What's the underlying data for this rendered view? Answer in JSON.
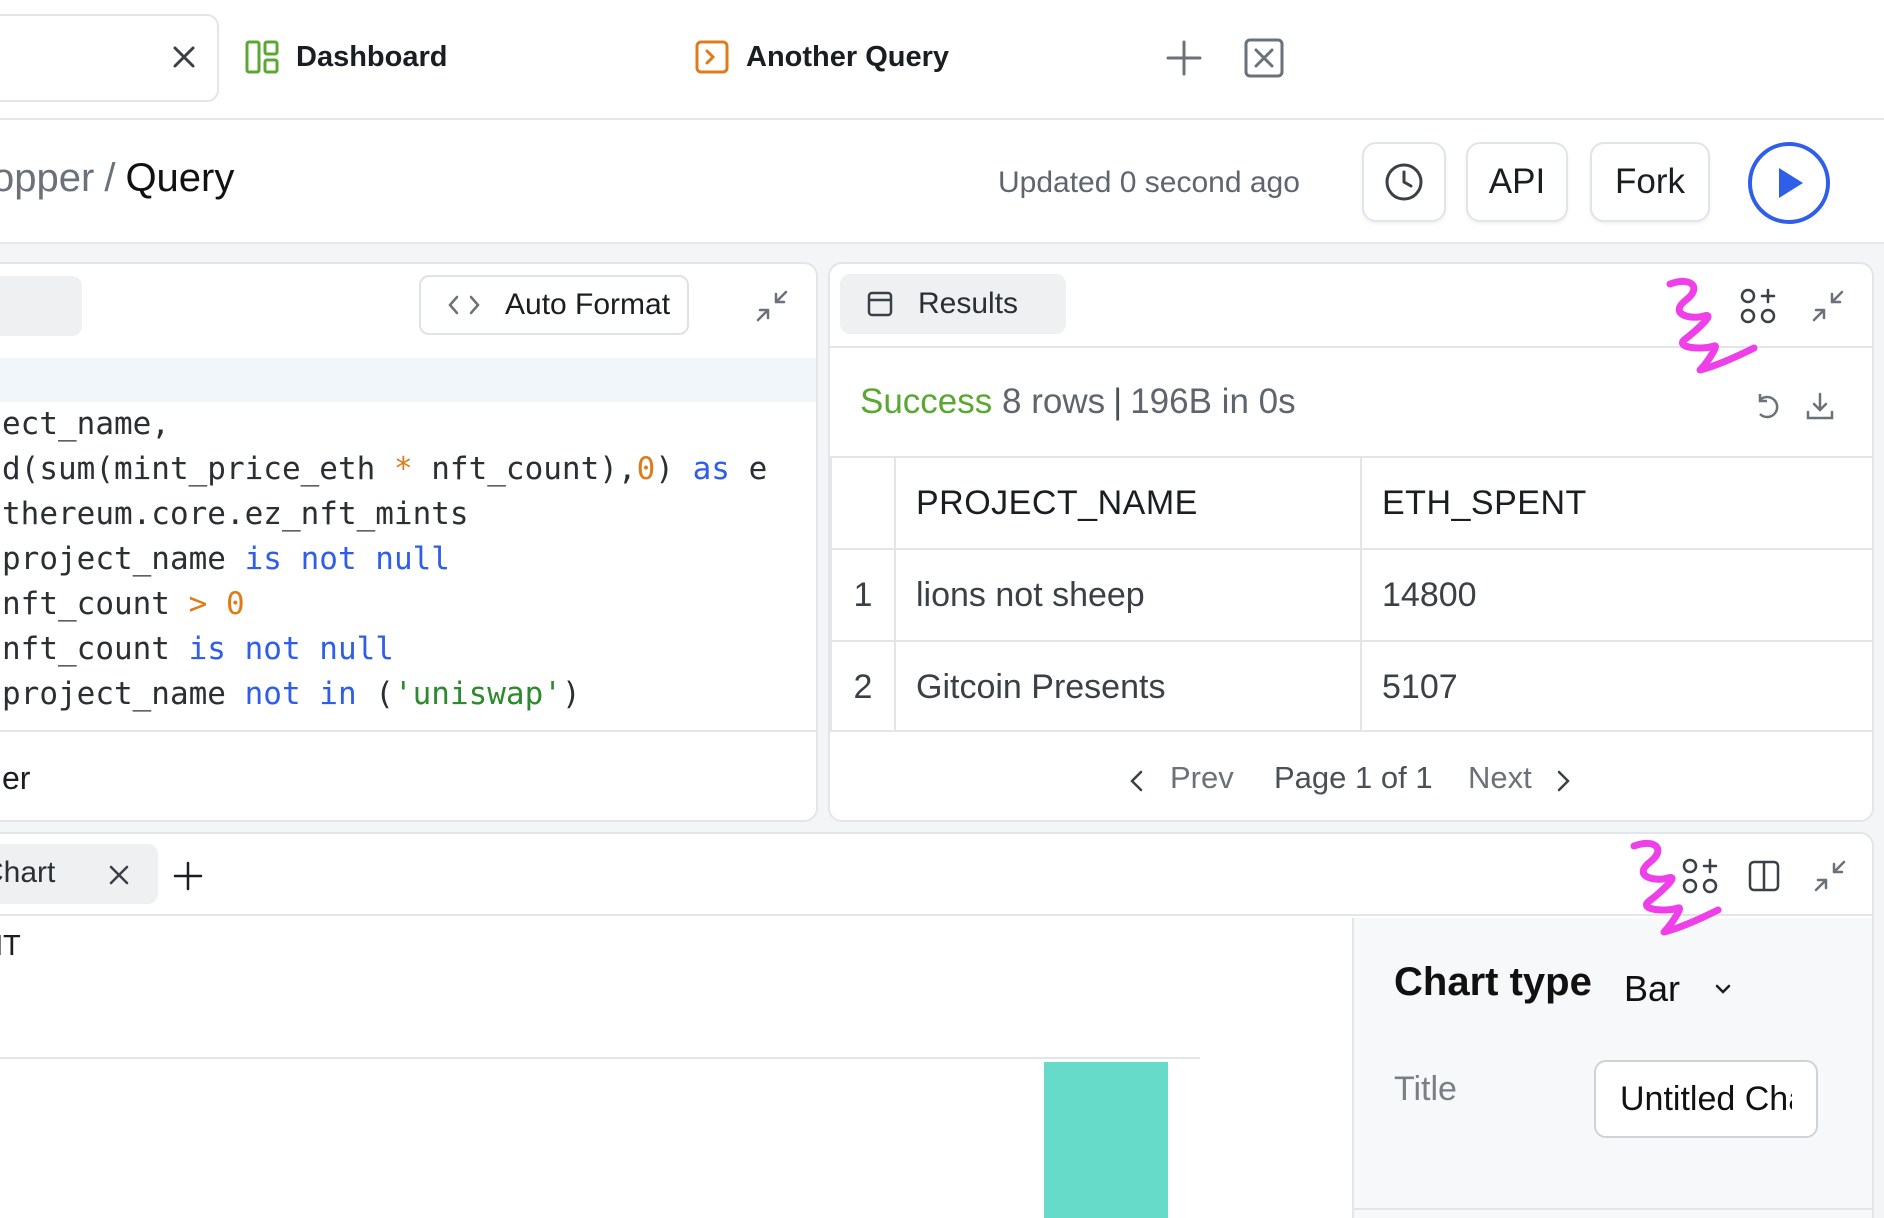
{
  "tabs": {
    "items": [
      {
        "label": "Dashboard",
        "icon": "dashboard-icon",
        "color": "#5aa832"
      },
      {
        "label": "Another Query",
        "icon": "query-icon",
        "color": "#e07b1a"
      }
    ]
  },
  "header": {
    "breadcrumb_parent": "opper",
    "breadcrumb_separator": "/",
    "breadcrumb_current": "Query",
    "updated": "Updated 0 second ago",
    "history_icon": "clock-icon",
    "api_label": "API",
    "fork_label": "Fork",
    "run_icon": "play-icon",
    "accent": "#2f5ee8"
  },
  "editor": {
    "auto_format_label": "Auto Format",
    "code_lines": [
      "ect_name,",
      "d(sum(mint_price_eth * nft_count),0) as e",
      "thereum.core.ez_nft_mints",
      "project_name is not null",
      "nft_count > 0",
      "nft_count is not null",
      "project_name not in ('uniswap')"
    ],
    "footer_text": "er"
  },
  "results": {
    "tab_label": "Results",
    "status_success": "Success",
    "status_rows": "8 rows",
    "status_sep": "|",
    "status_size": "196B in 0s",
    "columns": [
      "PROJECT_NAME",
      "ETH_SPENT"
    ],
    "rows": [
      {
        "index": "1",
        "project_name": "lions not sheep",
        "eth_spent": "14800"
      },
      {
        "index": "2",
        "project_name": "Gitcoin Presents",
        "eth_spent": "5107"
      }
    ],
    "pager": {
      "prev": "Prev",
      "page": "Page 1 of 1",
      "next": "Next"
    }
  },
  "chart_panel": {
    "tab_label": "Chart",
    "y_label_fragment": "NT",
    "bar_color": "#67dbc9",
    "config": {
      "chart_type_label": "Chart type",
      "chart_type_value": "Bar",
      "title_label": "Title",
      "title_value": "Untitled Chart"
    }
  },
  "annotation_color": "#ef3fe8"
}
